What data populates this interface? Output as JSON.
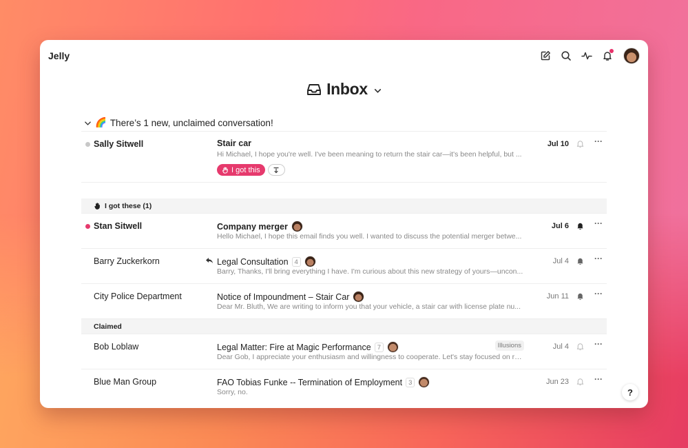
{
  "app": {
    "name": "Jelly"
  },
  "topbar": {
    "icons": [
      "compose-icon",
      "search-icon",
      "activity-icon",
      "bell-icon"
    ],
    "has_notification": true
  },
  "page": {
    "title": "Inbox"
  },
  "unclaimed": {
    "banner": "There’s 1 new, unclaimed conversation!",
    "banner_emoji": "🌈",
    "rows": [
      {
        "sender": "Sally Sitwell",
        "dot_color": "#c8c8c8",
        "subject": "Stair car",
        "preview": "Hi Michael, I hope you're well. I've been meaning to return the stair car—it's been helpful, but ...",
        "date": "Jul 10",
        "claim_label": "I got this"
      }
    ]
  },
  "sections": [
    {
      "title": "I got these (1)",
      "rows": [
        {
          "sender": "Stan Sitwell",
          "dot_color": "#e63a6d",
          "bold": true,
          "subject": "Company merger",
          "count": "",
          "preview": "Hello Michael, I hope this email finds you well. I wanted to discuss the potential merger betwe...",
          "date": "Jul 6",
          "reply": false,
          "bell": "filled"
        },
        {
          "sender": "Barry Zuckerkorn",
          "dot_color": "",
          "bold": false,
          "subject": "Legal Consultation",
          "count": "4",
          "preview": "Barry, Thanks, I'll bring everything I have. I'm curious about this new strategy of yours—uncon...",
          "date": "Jul 4",
          "reply": true,
          "bell": "filled"
        },
        {
          "sender": "City Police Department",
          "dot_color": "",
          "bold": false,
          "subject": "Notice of Impoundment – Stair Car",
          "count": "",
          "preview": "Dear Mr. Bluth, We are writing to inform you that your vehicle, a stair car with license plate nu...",
          "date": "Jun 11",
          "reply": false,
          "bell": "filled"
        }
      ]
    },
    {
      "title": "Claimed",
      "rows": [
        {
          "sender": "Bob Loblaw",
          "dot_color": "",
          "bold": false,
          "subject": "Legal Matter: Fire at Magic Performance",
          "count": "7",
          "tag": "Illusions",
          "preview": "Dear Gob, I appreciate your enthusiasm and willingness to cooperate. Let's stay focused on re...",
          "date": "Jul 4",
          "reply": false,
          "bell": "outline"
        },
        {
          "sender": "Blue Man Group",
          "dot_color": "",
          "bold": false,
          "subject": "FAO Tobias Funke -- Termination of Employment",
          "count": "3",
          "preview": "Sorry, no.",
          "date": "Jun 23",
          "reply": false,
          "bell": "outline"
        }
      ]
    }
  ],
  "help": {
    "label": "?"
  },
  "colors": {
    "accent": "#e63a6d"
  }
}
